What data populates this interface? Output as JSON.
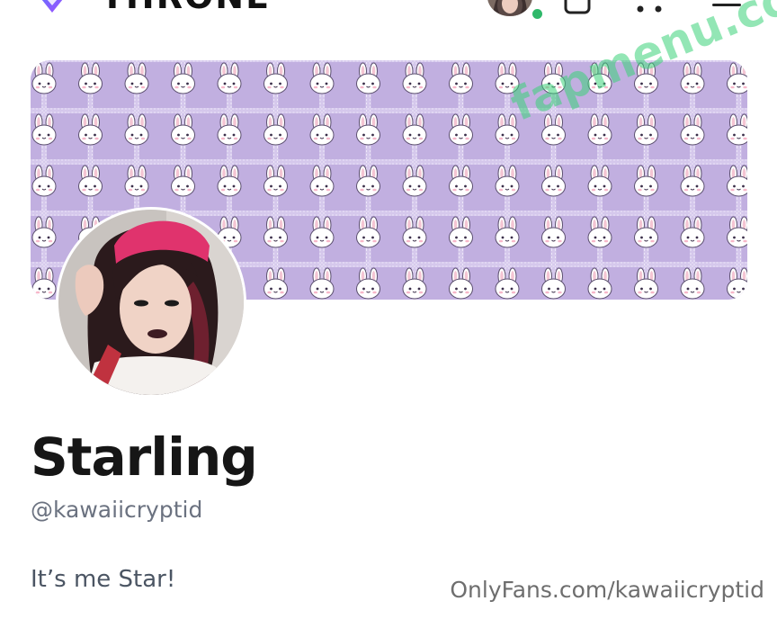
{
  "header": {
    "brand_name": "THRONE",
    "logo_icon": "throne-logo-icon",
    "nav_avatar_icon": "user-avatar",
    "online_status_color": "#2fb86a",
    "icons": [
      "bag-icon",
      "dots-icon",
      "menu-icon"
    ]
  },
  "banner": {
    "pattern": "bunny-plaid",
    "background_color": "#c1afe0"
  },
  "profile": {
    "display_name": "Starling",
    "handle": "@kawaiicryptid",
    "bio": "It’s me Star!",
    "accent_color": "#e0336d"
  },
  "watermarks": {
    "onlyfans": "OnlyFans.com/kawaiicryptid",
    "site": "fapmenu.com"
  }
}
